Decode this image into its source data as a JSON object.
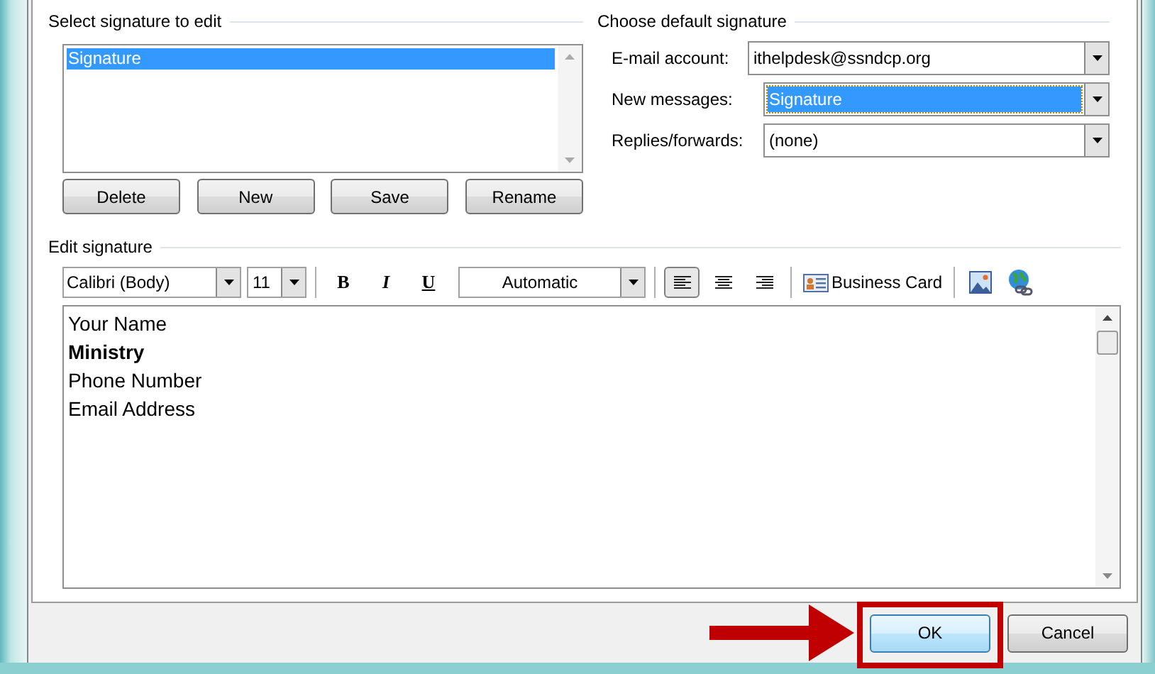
{
  "select_signature": {
    "label": "Select signature to edit",
    "items": [
      {
        "label": "Signature",
        "selected": true
      }
    ],
    "buttons": [
      "Delete",
      "New",
      "Save",
      "Rename"
    ]
  },
  "default_signature": {
    "label": "Choose default signature",
    "fields": [
      {
        "label": "E-mail account:",
        "value": "ithelpdesk@ssndcp.org",
        "selected": false
      },
      {
        "label": "New messages:",
        "value": "Signature",
        "selected": true
      },
      {
        "label": "Replies/forwards:",
        "value": "(none)",
        "selected": false
      }
    ]
  },
  "edit_signature": {
    "label": "Edit signature",
    "font": "Calibri (Body)",
    "size": "11",
    "format": [
      {
        "label": "B",
        "kind": "bold"
      },
      {
        "label": "I",
        "kind": "italic"
      },
      {
        "label": "U",
        "kind": "underline"
      }
    ],
    "font_color_label": "Automatic",
    "alignment": [
      {
        "kind": "left",
        "selected": true
      },
      {
        "kind": "center",
        "selected": false
      },
      {
        "kind": "right",
        "selected": false
      }
    ],
    "business_card": "Business Card",
    "lines": [
      {
        "text": "Your Name",
        "bold": false
      },
      {
        "text": "Ministry",
        "bold": true
      },
      {
        "text": "Phone Number",
        "bold": false
      },
      {
        "text": "Email Address",
        "bold": false
      }
    ]
  },
  "buttons": [
    {
      "label": "OK",
      "default": true,
      "highlighted": true
    },
    {
      "label": "Cancel",
      "default": false,
      "highlighted": false
    }
  ]
}
